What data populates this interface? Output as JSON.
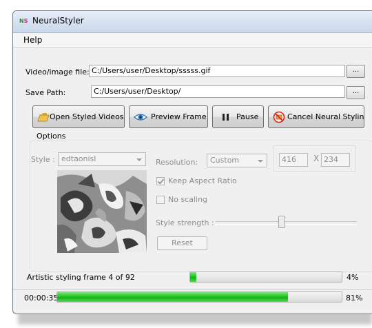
{
  "window": {
    "title": "NeuralStyler",
    "icon_text_m": "N",
    "icon_text_s": "S"
  },
  "menu": {
    "help": "Help"
  },
  "file": {
    "video_label": "Video/image file:",
    "video_value": "C:/Users/user/Desktop/sssss.gif",
    "browse_label": "...",
    "save_label": "Save Path:",
    "save_value": "C:/Users/user/Desktop/"
  },
  "toolbar": {
    "open_styled": "Open Styled Videos",
    "preview_frame": "Preview Frame",
    "pause": "Pause",
    "cancel": "Cancel Neural Styling"
  },
  "options": {
    "title": "Options",
    "style_label": "Style :",
    "style_value": "edtaonisl",
    "resolution_label": "Resolution:",
    "resolution_value": "Custom",
    "width": "416",
    "x_sep": "X",
    "height": "234",
    "keep_aspect": "Keep Aspect Ratio",
    "keep_aspect_checked": true,
    "no_scaling": "No scaling",
    "no_scaling_checked": false,
    "style_strength_label": "Style strength :",
    "style_strength_level": 0.47,
    "reset": "Reset"
  },
  "progress": {
    "frame_label": "Artistic styling frame 4 of 92",
    "frame_percent_text": "4%",
    "frame_fraction": 0.04,
    "elapsed": "00:00:35",
    "total_percent_text": "81%",
    "total_fraction": 0.81
  },
  "colors": {
    "progress_green": "#1fc61f",
    "title_gradient_top": "#e6eef8"
  }
}
